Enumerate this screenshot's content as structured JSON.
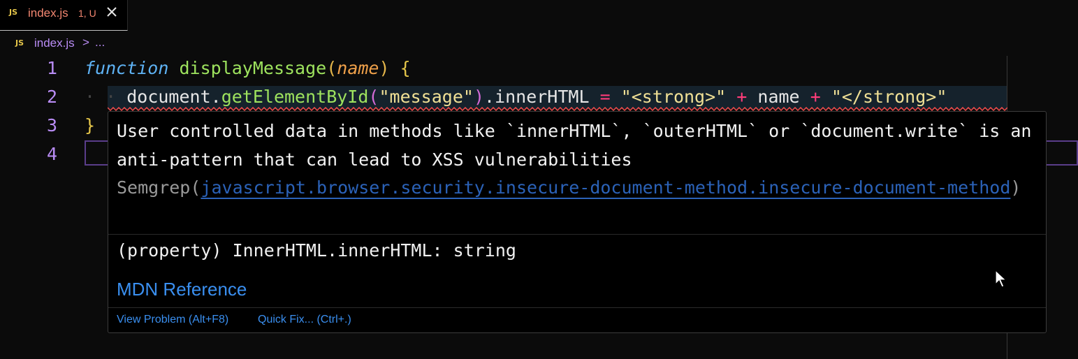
{
  "tab": {
    "icon": "JS",
    "title": "index.js",
    "status": "1, U"
  },
  "breadcrumb": {
    "icon": "JS",
    "file": "index.js",
    "separator": ">",
    "more": "..."
  },
  "editor": {
    "line_numbers": [
      "1",
      "2",
      "3",
      "4"
    ],
    "line1": {
      "keyword": "function",
      "name": "displayMessage",
      "open_paren": "(",
      "param": "name",
      "close_paren": ")",
      "brace": "{"
    },
    "line2": {
      "indent_dots": "· · ",
      "object": "document.",
      "method": "getElementById",
      "open_paren": "(",
      "arg": "\"message\"",
      "close_paren": ")",
      "prop": ".innerHTML",
      "assign": "=",
      "str1": "\"<strong>\"",
      "plus1": "+",
      "var": "name",
      "plus2": "+",
      "str2": "\"</strong>\""
    },
    "line3": {
      "brace": "}"
    }
  },
  "hover": {
    "message": "User controlled data in methods like `innerHTML`, `outerHTML` or `document.write` is an anti-pattern that can lead to XSS vulnerabilities",
    "source": "Semgrep",
    "rule_open": "(",
    "rule": "javascript.browser.security.insecure-document-method.insecure-document-method",
    "rule_close": ")",
    "signature": "(property) InnerHTML.innerHTML: string",
    "mdn_link": "MDN Reference",
    "actions": {
      "view_problem": "View Problem (Alt+F8)",
      "quick_fix": "Quick Fix... (Ctrl+.)"
    }
  },
  "colors": {
    "accent_link": "#3a8ff0",
    "error_squiggle": "#f14c4c",
    "line_number": "#b98cf5"
  }
}
